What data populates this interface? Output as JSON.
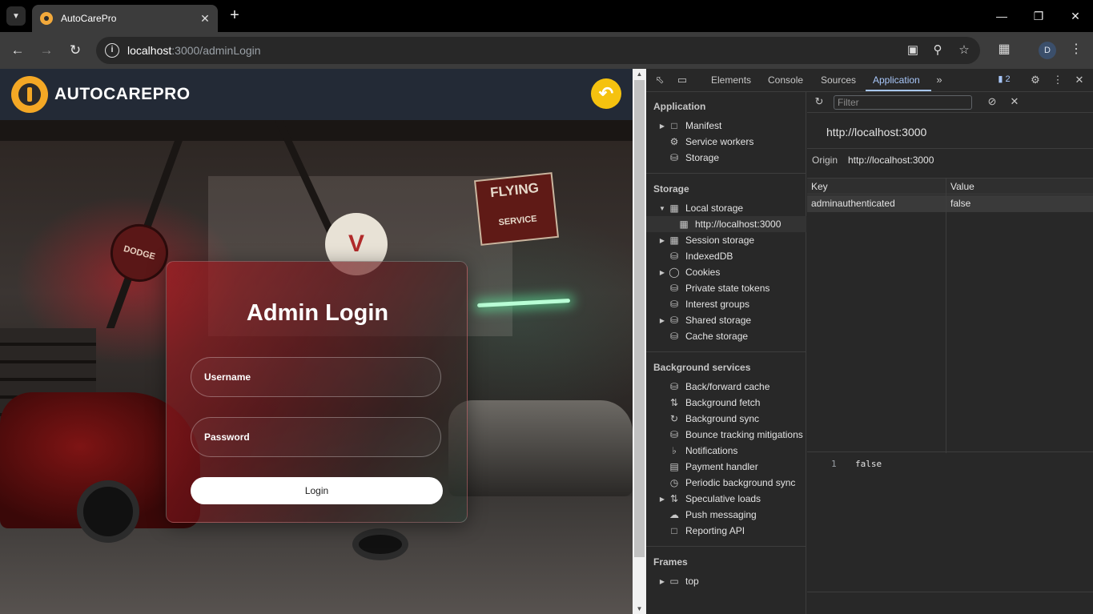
{
  "browser": {
    "tab_title": "AutoCarePro",
    "url_host": "localhost",
    "url_path": ":3000/adminLogin",
    "profile_initial": "D"
  },
  "site": {
    "brand": "AUTOCAREPRO",
    "login_title": "Admin Login",
    "username_placeholder": "Username",
    "password_placeholder": "Password",
    "login_button": "Login",
    "signs": {
      "dodge": "DODGE",
      "flying_top": "FLYING",
      "flying_bottom": "SERVICE",
      "v": "V"
    }
  },
  "devtools": {
    "tabs": [
      "Elements",
      "Console",
      "Sources",
      "Application"
    ],
    "active_tab": "Application",
    "issues_count": "2",
    "filter_placeholder": "Filter",
    "sidebar": {
      "application": {
        "heading": "Application",
        "items": [
          "Manifest",
          "Service workers",
          "Storage"
        ]
      },
      "storage": {
        "heading": "Storage",
        "items": [
          "Local storage",
          "http://localhost:3000",
          "Session storage",
          "IndexedDB",
          "Cookies",
          "Private state tokens",
          "Interest groups",
          "Shared storage",
          "Cache storage"
        ]
      },
      "background": {
        "heading": "Background services",
        "items": [
          "Back/forward cache",
          "Background fetch",
          "Background sync",
          "Bounce tracking mitigations",
          "Notifications",
          "Payment handler",
          "Periodic background sync",
          "Speculative loads",
          "Push messaging",
          "Reporting API"
        ]
      },
      "frames": {
        "heading": "Frames",
        "items": [
          "top"
        ]
      }
    },
    "origin_title": "http://localhost:3000",
    "origin_label": "Origin",
    "origin_value": "http://localhost:3000",
    "table": {
      "headers": [
        "Key",
        "Value"
      ],
      "rows": [
        {
          "key": "adminauthenticated",
          "value": "false"
        }
      ]
    },
    "preview": {
      "line": "1",
      "text": "false"
    }
  }
}
